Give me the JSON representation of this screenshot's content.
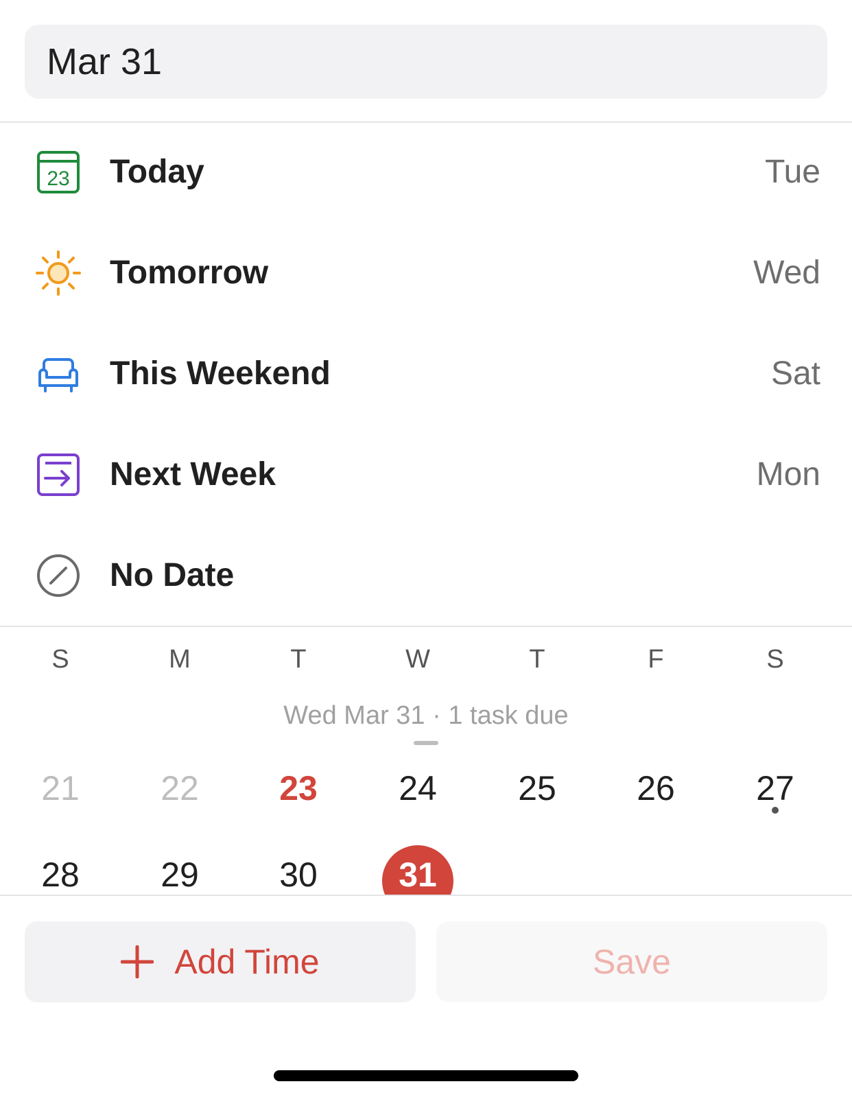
{
  "date_input": {
    "value": "Mar 31"
  },
  "quick_options": [
    {
      "label": "Today",
      "day": "Tue",
      "icon": "calendar-today-icon",
      "color": "#1f8b3b",
      "icon_text": "23"
    },
    {
      "label": "Tomorrow",
      "day": "Wed",
      "icon": "sun-icon",
      "color": "#f19a1a"
    },
    {
      "label": "This Weekend",
      "day": "Sat",
      "icon": "sofa-icon",
      "color": "#2f7de1"
    },
    {
      "label": "Next Week",
      "day": "Mon",
      "icon": "arrow-into-box-icon",
      "color": "#7a3fcf"
    },
    {
      "label": "No Date",
      "day": "",
      "icon": "no-date-circle-slash-icon",
      "color": "#6a6a6a"
    }
  ],
  "calendar": {
    "weekdays": [
      "S",
      "M",
      "T",
      "W",
      "T",
      "F",
      "S"
    ],
    "summary": "Wed Mar 31 · 1 task due",
    "week1": [
      "21",
      "22",
      "23",
      "24",
      "25",
      "26",
      "27"
    ],
    "week2": [
      "28",
      "29",
      "30",
      "31"
    ],
    "today": "23",
    "selected": "31",
    "accent_color": "#d1453b"
  },
  "buttons": {
    "add_time": "Add Time",
    "save": "Save"
  }
}
